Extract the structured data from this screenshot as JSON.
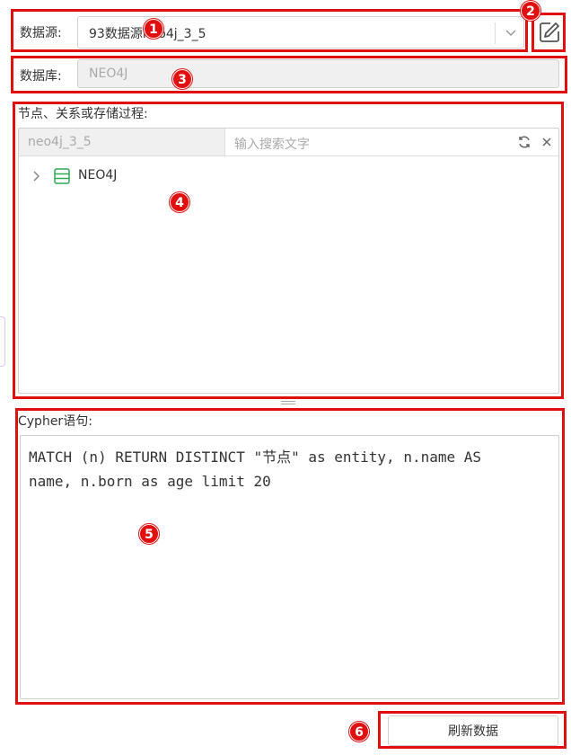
{
  "datasource": {
    "label": "数据源:",
    "value": "93数据源neo4j_3_5"
  },
  "database": {
    "label": "数据库:",
    "value": "NEO4J"
  },
  "tree": {
    "section_label": "节点、关系或存储过程:",
    "filter_value": "neo4j_3_5",
    "search_placeholder": "输入搜索文字",
    "items": [
      {
        "label": "NEO4J",
        "icon": "database-icon"
      }
    ]
  },
  "cypher": {
    "label": "Cypher语句:",
    "line1": "MATCH (n) RETURN DISTINCT \"节点\" as entity, n.name AS",
    "line2": "name, n.born as age limit 20"
  },
  "refresh_button": "刷新数据",
  "badges": [
    "1",
    "2",
    "3",
    "4",
    "5",
    "6"
  ],
  "colors": {
    "highlight": "#e01010",
    "tree_icon": "#2eaa55",
    "disabled_bg": "#f0f0f0"
  }
}
